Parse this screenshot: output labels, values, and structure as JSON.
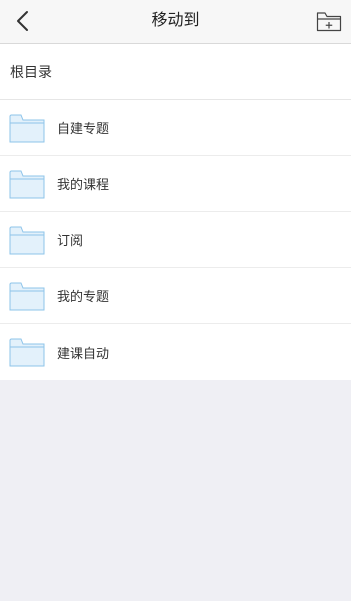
{
  "nav": {
    "title": "移动到",
    "back_icon": "chevron-left-icon",
    "new_folder_icon": "folder-plus-icon"
  },
  "root": {
    "label": "根目录"
  },
  "folders": [
    {
      "name": "自建专题"
    },
    {
      "name": "我的课程"
    },
    {
      "name": "订阅"
    },
    {
      "name": "我的专题"
    },
    {
      "name": "建课自动"
    }
  ],
  "colors": {
    "folder_fill": "#e3f1fb",
    "folder_stroke": "#8ec4ea",
    "nav_bg": "#f7f7f7",
    "page_bg": "#efeff4"
  }
}
